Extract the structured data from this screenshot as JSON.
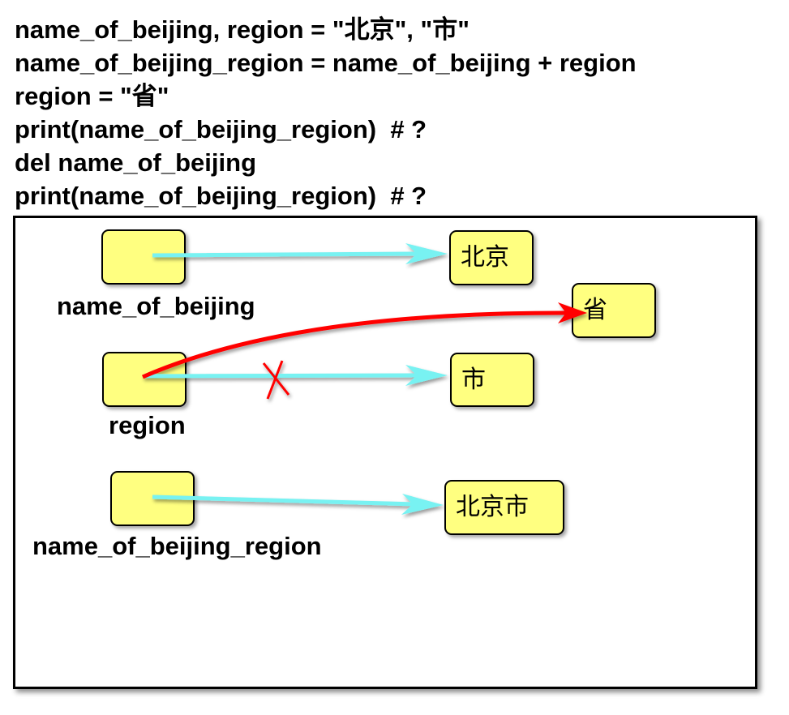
{
  "code_lines": [
    "name_of_beijing, region = \"北京\", \"市\"",
    "name_of_beijing_region = name_of_beijing + region",
    "region = \"省\"",
    "print(name_of_beijing_region)  # ?",
    "del name_of_beijing",
    "print(name_of_beijing_region)  # ?"
  ],
  "variables": {
    "name_of_beijing": "name_of_beijing",
    "region": "region",
    "name_of_beijing_region": "name_of_beijing_region"
  },
  "values": {
    "beijing": "北京",
    "sheng": "省",
    "shi": "市",
    "beijingshi": "北京市"
  },
  "colors": {
    "box_fill": "#ffff80",
    "reference_arrow": "#70f0f0",
    "rebind_arrow": "#ff0000"
  }
}
